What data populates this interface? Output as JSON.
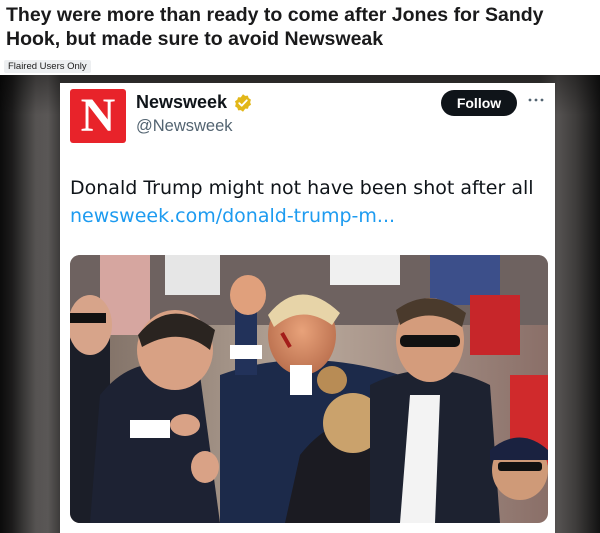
{
  "post": {
    "title": "They were more than ready to come after Jones for Sandy Hook, but made sure to avoid Newsweak",
    "flair": "Flaired Users Only"
  },
  "tweet": {
    "logo_letter": "N",
    "account_name": "Newsweek",
    "handle": "@Newsweek",
    "follow_label": "Follow",
    "text": "Donald Trump might not have been shot after all",
    "link": "newsweek.com/donald-trump-m...",
    "photo_caption_icon": "photo"
  },
  "colors": {
    "logo_red": "#e8232a",
    "link_blue": "#1d9bf0",
    "verified_gold": "#e2b719",
    "follow_bg": "#0f1419"
  }
}
